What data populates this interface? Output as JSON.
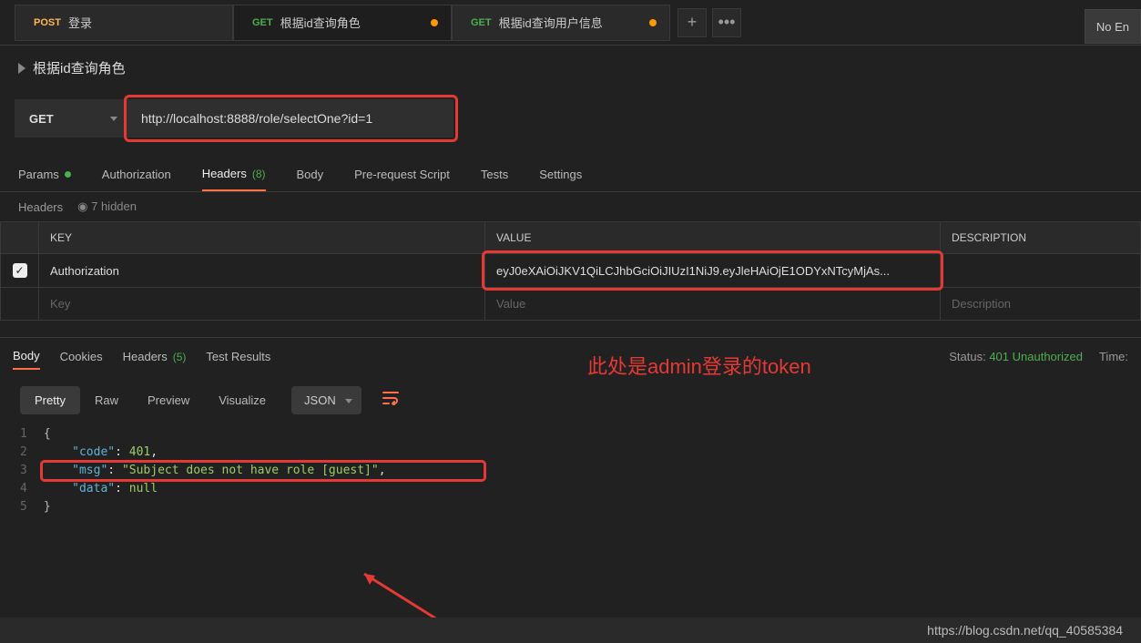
{
  "tabs": [
    {
      "method": "POST",
      "label": "登录",
      "unsaved": false
    },
    {
      "method": "GET",
      "label": "根据id查询角色",
      "unsaved": true
    },
    {
      "method": "GET",
      "label": "根据id查询用户信息",
      "unsaved": true
    }
  ],
  "topRightBtn": "No En",
  "requestName": "根据id查询角色",
  "request": {
    "method": "GET",
    "url": "http://localhost:8888/role/selectOne?id=1"
  },
  "reqTabs": {
    "params": "Params",
    "authorization": "Authorization",
    "headers": "Headers",
    "headersCount": "(8)",
    "body": "Body",
    "prerequest": "Pre-request Script",
    "tests": "Tests",
    "settings": "Settings"
  },
  "headersSub": {
    "label": "Headers",
    "hidden": "7 hidden"
  },
  "headersTable": {
    "colKey": "KEY",
    "colValue": "VALUE",
    "colDesc": "DESCRIPTION",
    "rows": [
      {
        "enabled": true,
        "key": "Authorization",
        "value": "eyJ0eXAiOiJKV1QiLCJhbGciOiJIUzI1NiJ9.eyJleHAiOjE1ODYxNTcyMjAs...",
        "desc": ""
      }
    ],
    "placeholderKey": "Key",
    "placeholderValue": "Value",
    "placeholderDesc": "Description"
  },
  "annotation": "此处是admin登录的token",
  "responseTabs": {
    "body": "Body",
    "cookies": "Cookies",
    "headers": "Headers",
    "headersCount": "(5)",
    "tests": "Test Results"
  },
  "responseStatus": {
    "statusLabel": "Status:",
    "statusValue": "401 Unauthorized",
    "timeLabel": "Time:"
  },
  "bodyToolbar": {
    "pretty": "Pretty",
    "raw": "Raw",
    "preview": "Preview",
    "visualize": "Visualize",
    "format": "JSON"
  },
  "responseBody": {
    "lines": [
      "1",
      "2",
      "3",
      "4",
      "5"
    ],
    "json": {
      "code": 401,
      "msg": "Subject does not have role [guest]",
      "data": null
    }
  },
  "watermark": "https://blog.csdn.net/qq_40585384"
}
